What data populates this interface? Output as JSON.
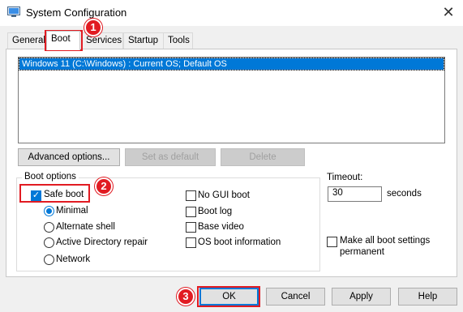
{
  "window": {
    "title": "System Configuration",
    "close_glyph": "✕",
    "app_icon": "msconfig-icon"
  },
  "tabs": [
    {
      "label": "General",
      "active": false
    },
    {
      "label": "Boot",
      "active": true
    },
    {
      "label": "Services",
      "active": false
    },
    {
      "label": "Startup",
      "active": false
    },
    {
      "label": "Tools",
      "active": false
    }
  ],
  "boot_list": {
    "entries": [
      "Windows 11 (C:\\Windows) : Current OS; Default OS"
    ],
    "selected_index": 0
  },
  "list_buttons": {
    "advanced": "Advanced options...",
    "set_default": "Set as default",
    "delete": "Delete"
  },
  "boot_options": {
    "group_label": "Boot options",
    "safe_boot": {
      "label": "Safe boot",
      "checked": true
    },
    "radios": [
      {
        "label": "Minimal",
        "checked": true
      },
      {
        "label": "Alternate shell",
        "checked": false
      },
      {
        "label": "Active Directory repair",
        "checked": false
      },
      {
        "label": "Network",
        "checked": false
      }
    ],
    "right_checks": [
      {
        "label": "No GUI boot",
        "checked": false
      },
      {
        "label": "Boot log",
        "checked": false
      },
      {
        "label": "Base video",
        "checked": false
      },
      {
        "label": "OS boot information",
        "checked": false
      }
    ]
  },
  "timeout": {
    "label": "Timeout:",
    "value": "30",
    "unit": "seconds"
  },
  "make_permanent": {
    "line1": "Make all boot settings",
    "line2": "permanent",
    "checked": false
  },
  "footer_buttons": {
    "ok": "OK",
    "cancel": "Cancel",
    "apply": "Apply",
    "help": "Help"
  },
  "annotations": {
    "step1": "1",
    "step2": "2",
    "step3": "3",
    "highlight_color": "#e11b22"
  },
  "colors": {
    "accent": "#0078d7",
    "selection": "#0078d7"
  }
}
